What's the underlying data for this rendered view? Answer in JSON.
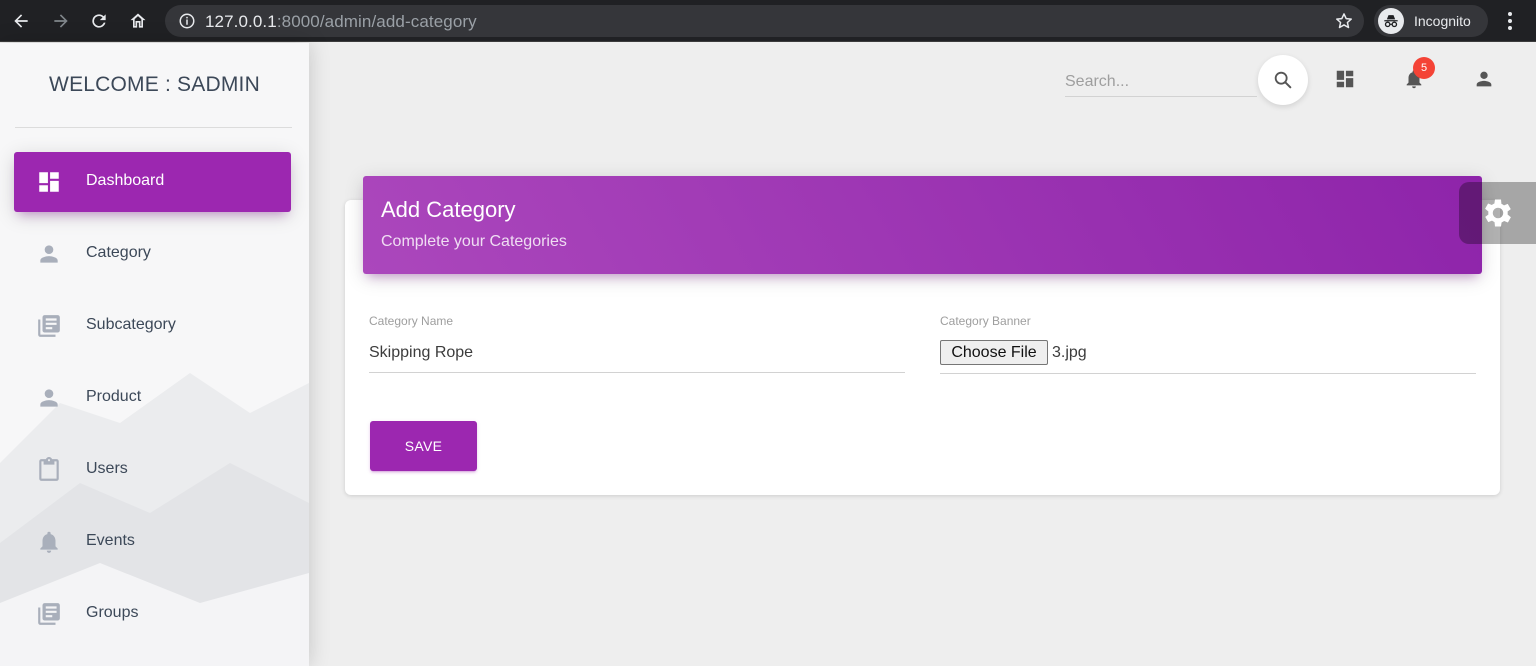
{
  "browser": {
    "url_host": "127.0.0.1",
    "url_rest": ":8000/admin/add-category",
    "profile_label": "Incognito"
  },
  "sidebar": {
    "brand": "WELCOME : SADMIN",
    "items": [
      {
        "label": "Dashboard",
        "icon": "dashboard-icon",
        "active": true
      },
      {
        "label": "Category",
        "icon": "person-icon"
      },
      {
        "label": "Subcategory",
        "icon": "library-books-icon"
      },
      {
        "label": "Product",
        "icon": "person-icon"
      },
      {
        "label": "Users",
        "icon": "content-paste-icon"
      },
      {
        "label": "Events",
        "icon": "notifications-icon"
      },
      {
        "label": "Groups",
        "icon": "library-books-icon"
      }
    ]
  },
  "topbar": {
    "search_placeholder": "Search...",
    "notification_count": "5"
  },
  "card": {
    "title": "Add Category",
    "subtitle": "Complete your Categories",
    "category_name_label": "Category Name",
    "category_name_value": "Skipping Rope",
    "category_banner_label": "Category Banner",
    "choose_file_label": "Choose File",
    "file_name": "3.jpg",
    "save_label": "SAVE"
  },
  "colors": {
    "accent": "#9c27b0",
    "badge": "#f44336"
  }
}
